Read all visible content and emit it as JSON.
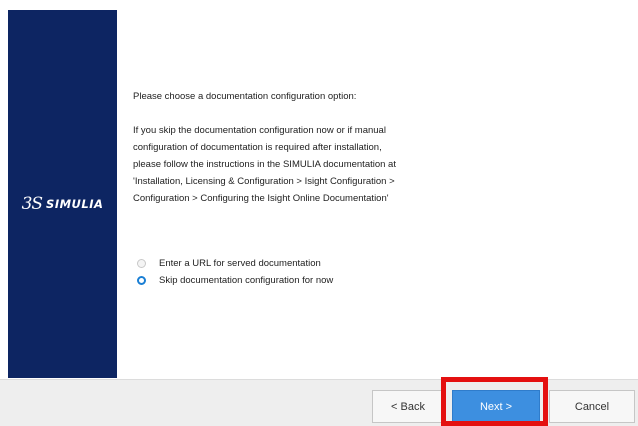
{
  "brand": {
    "mark": "3S",
    "name": "SIMULIA"
  },
  "content": {
    "prompt": "Please choose a documentation configuration option:",
    "info_lines": [
      "If you skip the documentation configuration now or if manual",
      "configuration of documentation is required after installation,",
      "please follow the instructions in the SIMULIA documentation at",
      "'Installation, Licensing & Configuration > Isight Configuration >",
      "Configuration > Configuring the Isight Online Documentation'"
    ]
  },
  "options": [
    {
      "label": "Enter a URL for served documentation",
      "selected": false
    },
    {
      "label": "Skip documentation configuration for now",
      "selected": true
    }
  ],
  "footer": {
    "back_label": "< Back",
    "next_label": "Next >",
    "cancel_label": "Cancel"
  },
  "colors": {
    "sidebar": "#0d2562",
    "accent": "#3d8fe0",
    "highlight": "#e41010"
  }
}
